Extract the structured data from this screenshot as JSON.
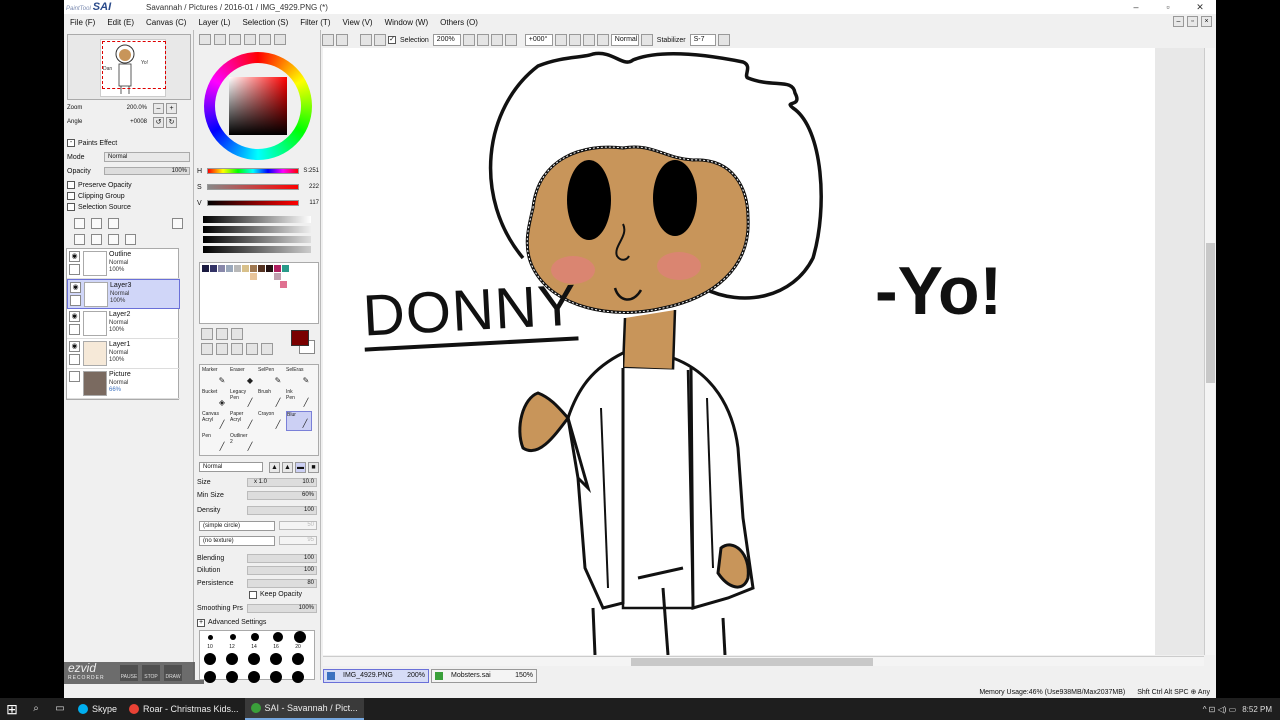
{
  "window": {
    "title": "Savannah / Pictures / 2016-01 / IMG_4929.PNG (*)",
    "app_name": "SAI",
    "app_prefix": "PaintTool",
    "controls": [
      "–",
      "▫",
      "✕"
    ]
  },
  "menu": [
    "File (F)",
    "Edit (E)",
    "Canvas (C)",
    "Layer (L)",
    "Selection (S)",
    "Filter (T)",
    "View (V)",
    "Window (W)",
    "Others (O)"
  ],
  "toolbar": {
    "selection_label": "Selection",
    "zoom": "200%",
    "rotation": "+000°",
    "blend_mode": "Normal",
    "stabilizer_label": "Stabilizer",
    "stabilizer_value": "S-7"
  },
  "navigator": {
    "zoom_label": "Zoom",
    "zoom_value": "200.0%",
    "angle_label": "Angle",
    "angle_value": "+0008"
  },
  "paint_effect": {
    "header": "Paints Effect",
    "mode_label": "Mode",
    "mode_value": "Normal",
    "opacity_label": "Opacity",
    "opacity_value": "100%",
    "preserve_opacity": "Preserve Opacity",
    "clipping_group": "Clipping Group",
    "selection_source": "Selection Source"
  },
  "layers": [
    {
      "name": "Outline",
      "mode": "Normal",
      "opacity": "100%",
      "selected": false
    },
    {
      "name": "Layer3",
      "mode": "Normal",
      "opacity": "100%",
      "selected": true
    },
    {
      "name": "Layer2",
      "mode": "Normal",
      "opacity": "100%",
      "selected": false
    },
    {
      "name": "Layer1",
      "mode": "Normal",
      "opacity": "100%",
      "selected": false
    },
    {
      "name": "Picture",
      "mode": "Normal",
      "opacity": "66%",
      "selected": false
    }
  ],
  "color": {
    "h_label": "H",
    "h_value": "S:251",
    "s_label": "S",
    "s_value": "222",
    "v_label": "V",
    "v_value": "117",
    "current": "#7a0000"
  },
  "brushes": [
    {
      "name": "Marker",
      "sub": ""
    },
    {
      "name": "Eraser",
      "sub": ""
    },
    {
      "name": "SelPen",
      "sub": ""
    },
    {
      "name": "SelEras",
      "sub": ""
    },
    {
      "name": "Bucket",
      "sub": ""
    },
    {
      "name": "Legacy",
      "sub": "Pen"
    },
    {
      "name": "Brush",
      "sub": ""
    },
    {
      "name": "Ink",
      "sub": "Pen"
    },
    {
      "name": "Canvas",
      "sub": "Acryl"
    },
    {
      "name": "Paper",
      "sub": "Acryl"
    },
    {
      "name": "Crayon",
      "sub": ""
    },
    {
      "name": "Blur",
      "sub": ""
    },
    {
      "name": "Pen",
      "sub": ""
    },
    {
      "name": "Outliner",
      "sub": "2"
    }
  ],
  "brush_settings": {
    "mode": "Normal",
    "size_label": "Size",
    "size_mult": "x 1.0",
    "size_value": "10.0",
    "min_size_label": "Min Size",
    "min_size_value": "60%",
    "density_label": "Density",
    "density_value": "100",
    "shape": "(simple circle)",
    "texture": "(no texture)",
    "shape_strength": "50",
    "texture_strength": "95",
    "blending_label": "Blending",
    "blending_value": "100",
    "dilution_label": "Dilution",
    "dilution_value": "100",
    "persistence_label": "Persistence",
    "persistence_value": "80",
    "keep_opacity": "Keep Opacity",
    "smoothing_label": "Smoothing Prs",
    "smoothing_value": "100%",
    "advanced": "Advanced Settings"
  },
  "brush_sizes": [
    "10",
    "12",
    "14",
    "16",
    "20"
  ],
  "documents": [
    {
      "name": "IMG_4929.PNG",
      "zoom": "200%",
      "active": true
    },
    {
      "name": "Mobsters.sai",
      "zoom": "150%",
      "active": false
    }
  ],
  "status": {
    "memory": "Memory Usage:46% (Use938MB/Max2037MB)",
    "keys": "Shft Ctrl Alt SPC ⊕ Any"
  },
  "recorder": {
    "brand": "ezvid",
    "brand_sub": "RECORDER",
    "buttons": [
      "PAUSE",
      "STOP",
      "DRAW"
    ]
  },
  "artwork": {
    "text_left": "DONNY",
    "text_right": "-Yo!",
    "skin": "#c8955a",
    "blush": "#e0807a"
  },
  "taskbar": {
    "items": [
      {
        "name": "Skype",
        "color": "#00aff0",
        "active": false
      },
      {
        "name": "Roar - Christmas Kids...",
        "color": "#e94235",
        "active": false
      },
      {
        "name": "SAI - Savannah / Pict...",
        "color": "#3aa03a",
        "active": true
      }
    ],
    "time": "8:52 PM",
    "tray_icons": "^ ⊡ ◁) ▭"
  }
}
